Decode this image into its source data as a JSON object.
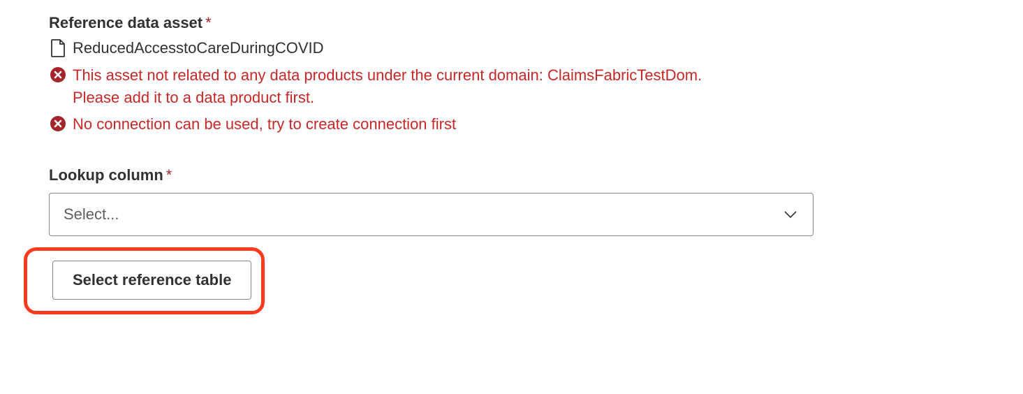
{
  "reference_asset": {
    "label": "Reference data asset",
    "required_mark": "*",
    "name": "ReducedAccesstoCareDuringCOVID",
    "errors": [
      "This asset not related to any data products under the current domain: ClaimsFabricTestDom. Please add it to a data product first.",
      "No connection can be used, try to create connection first"
    ]
  },
  "lookup_column": {
    "label": "Lookup column",
    "required_mark": "*",
    "placeholder": "Select..."
  },
  "actions": {
    "select_reference_table": "Select reference table"
  },
  "colors": {
    "error": "#c62828",
    "error_icon_bg": "#a4262c",
    "highlight": "#ff3b1f"
  }
}
